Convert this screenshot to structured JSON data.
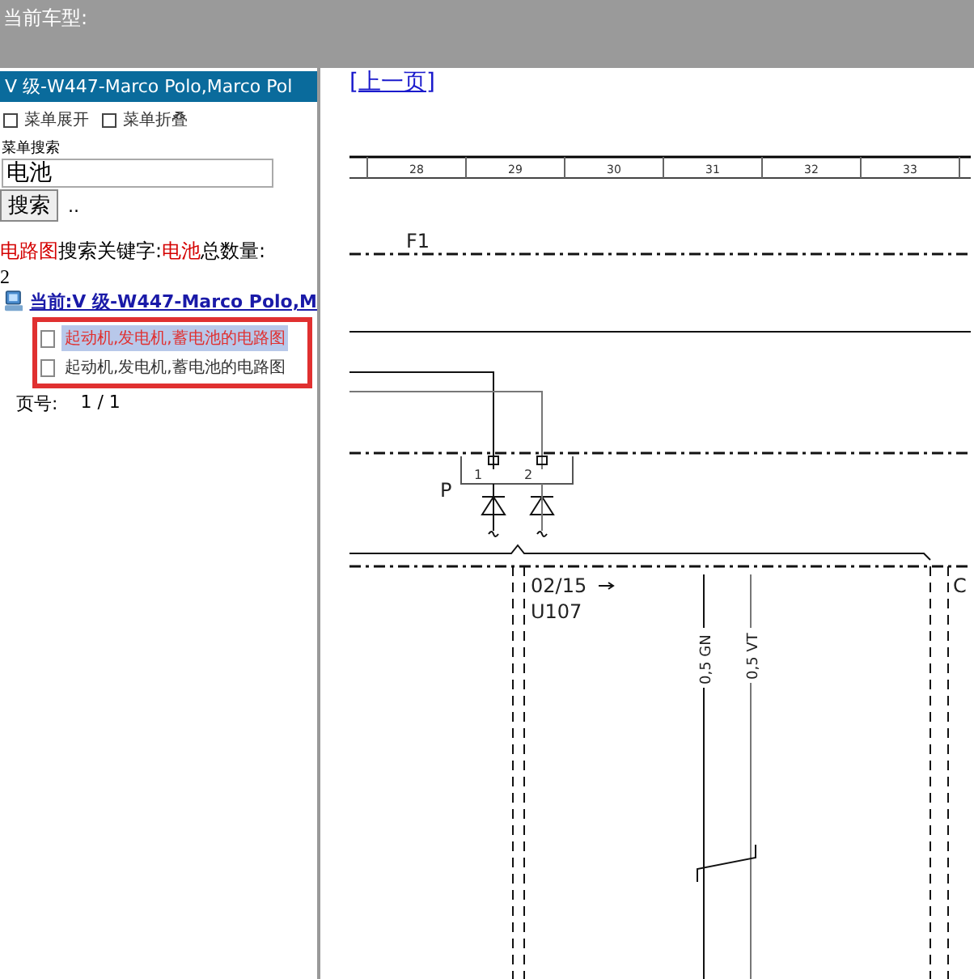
{
  "header": {
    "title": "当前车型:"
  },
  "sidebar": {
    "model_title": "V 级-W447-Marco Polo,Marco Pol",
    "menu_actions": [
      {
        "label": "菜单展开"
      },
      {
        "label": "菜单折叠"
      }
    ],
    "search": {
      "label": "菜单搜索",
      "value": "电池",
      "button": "搜索",
      "extra": ".."
    },
    "result": {
      "category": "电路图",
      "keyword_label": "搜索关键字:",
      "keyword": "电池",
      "count_label": "总数量:",
      "count": "2"
    },
    "tree": {
      "root": "当前:V 级-W447-Marco Polo,M",
      "children": [
        {
          "label": "起动机,发电机,蓄电池的电路图",
          "selected": true
        },
        {
          "label": "起动机,发电机,蓄电池的电路图",
          "selected": false
        }
      ]
    },
    "pager": {
      "label": "页号:",
      "value": "1 / 1"
    }
  },
  "viewer": {
    "prev_link": "[上一页]",
    "ruler": [
      "28",
      "29",
      "30",
      "31",
      "32",
      "33"
    ],
    "labels": {
      "fuse": "F1",
      "pin_1": "1",
      "pin_2": "2",
      "connector": "P",
      "ref": "02/15",
      "component": "U107",
      "wire_1": "0,5 GN",
      "wire_2": "0,5 VT",
      "next_block": "C"
    }
  }
}
